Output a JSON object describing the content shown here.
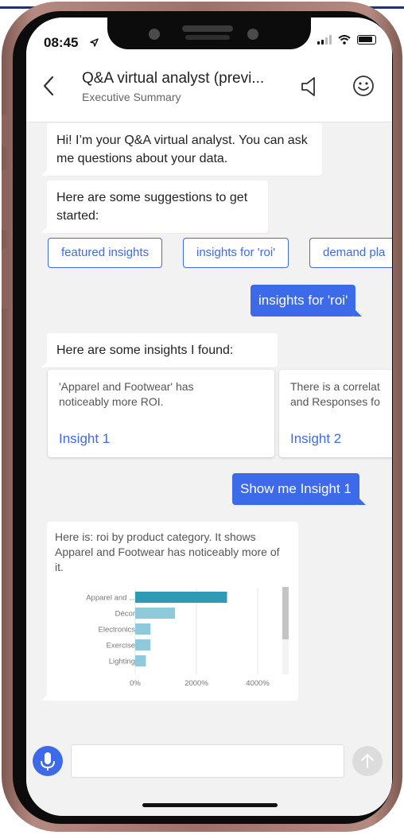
{
  "status": {
    "time": "08:45"
  },
  "header": {
    "title": "Q&A virtual analyst (previ...",
    "subtitle": "Executive Summary"
  },
  "messages": {
    "greeting": "Hi! I’m your Q&A virtual analyst. You can ask me questions about your data.",
    "suggest_intro": "Here are some suggestions to get started:",
    "chips": [
      "featured insights",
      "insights for 'roi'",
      "demand pla"
    ],
    "user_1": "insights for 'roi'",
    "insights_intro": "Here are some insights I found:",
    "cards": [
      {
        "text_1": "'Apparel and Footwear' has",
        "text_2": "noticeably more ROI.",
        "link": "Insight 1"
      },
      {
        "text_1": "There is a correlat",
        "text_2": "and Responses fo",
        "link": "Insight 2"
      }
    ],
    "user_2": "Show me Insight 1",
    "chart_caption": "Here is: roi by product category. It shows Apparel and Footwear has noticeably more of it."
  },
  "input": {
    "placeholder": ""
  },
  "colors": {
    "accent": "#3d6ae8",
    "bar_primary": "#2e9ab5",
    "bar_secondary": "#8dcadb"
  },
  "chart_data": {
    "type": "bar",
    "orientation": "horizontal",
    "categories": [
      "Apparel and ...",
      "Décor",
      "Electronics",
      "Exercise",
      "Lighting"
    ],
    "values": [
      3000,
      1300,
      500,
      500,
      350
    ],
    "x_ticks": [
      "0%",
      "2000%",
      "4000%"
    ],
    "xlim": [
      0,
      4000
    ],
    "grid": true
  }
}
